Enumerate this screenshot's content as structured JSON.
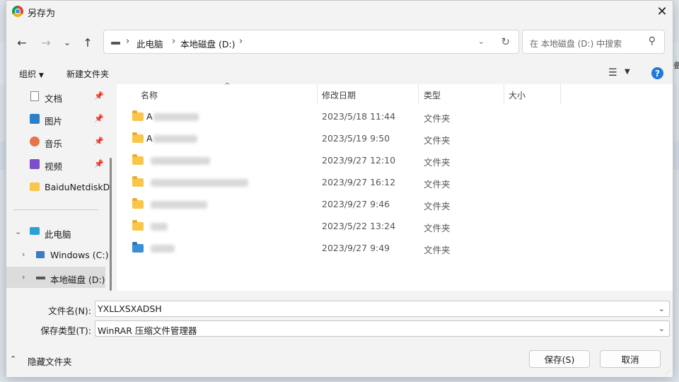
{
  "window": {
    "title": "另存为",
    "close_label": "✕"
  },
  "nav": {
    "back": "←",
    "forward": "→",
    "recent": "⌄",
    "up": "↑"
  },
  "address": {
    "crumbs": [
      "此电脑",
      "本地磁盘 (D:)"
    ],
    "separator": "›"
  },
  "search": {
    "placeholder": "在 本地磁盘 (D:) 中搜索"
  },
  "toolbar": {
    "organize": "组织",
    "new_folder": "新建文件夹",
    "help": "?"
  },
  "sidebar": {
    "quick": [
      {
        "label": "文档",
        "icon": "document-icon"
      },
      {
        "label": "图片",
        "icon": "picture-icon"
      },
      {
        "label": "音乐",
        "icon": "music-icon"
      },
      {
        "label": "视频",
        "icon": "video-icon"
      },
      {
        "label": "BaiduNetdiskD",
        "icon": "folder-icon"
      }
    ],
    "this_pc": "此电脑",
    "drives": [
      {
        "label": "Windows (C:)"
      },
      {
        "label": "本地磁盘 (D:)"
      }
    ]
  },
  "columns": {
    "name": "名称",
    "modified": "修改日期",
    "type": "类型",
    "size": "大小"
  },
  "files": [
    {
      "name": "A",
      "modified": "2023/5/18 11:44",
      "type": "文件夹",
      "kind": "folder"
    },
    {
      "name": "A",
      "modified": "2023/5/19 9:50",
      "type": "文件夹",
      "kind": "folder"
    },
    {
      "name": "",
      "modified": "2023/9/27 12:10",
      "type": "文件夹",
      "kind": "folder"
    },
    {
      "name": "",
      "modified": "2023/9/27 16:12",
      "type": "文件夹",
      "kind": "folder"
    },
    {
      "name": "",
      "modified": "2023/9/27 9:46",
      "type": "文件夹",
      "kind": "folder"
    },
    {
      "name": "",
      "modified": "2023/5/22 13:24",
      "type": "文件夹",
      "kind": "folder"
    },
    {
      "name": "",
      "modified": "2023/9/27 9:49",
      "type": "文件夹",
      "kind": "app"
    }
  ],
  "form": {
    "filename_label": "文件名(N):",
    "filename_value": "YXLLXSXADSH",
    "filetype_label": "保存类型(T):",
    "filetype_value": "WinRAR 压缩文件管理器"
  },
  "footer": {
    "hide_folders": "隐藏文件夹",
    "save": "保存(S)",
    "cancel": "取消"
  },
  "background": {
    "edge_text": "备"
  }
}
